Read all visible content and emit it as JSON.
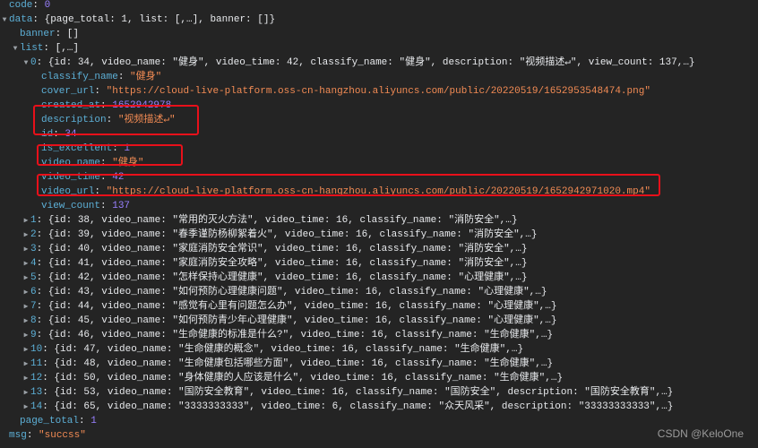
{
  "lines": [
    {
      "indent": 10,
      "tri": "",
      "parts": [
        [
          "key",
          "code"
        ],
        [
          "p",
          ": "
        ],
        [
          "num",
          "0"
        ]
      ]
    },
    {
      "indent": 10,
      "tri": "down",
      "parts": [
        [
          "key",
          "data"
        ],
        [
          "p",
          ": {page_total: 1, list: [,…], banner: []}"
        ]
      ]
    },
    {
      "indent": 22,
      "tri": "",
      "parts": [
        [
          "key",
          "banner"
        ],
        [
          "p",
          ": []"
        ]
      ]
    },
    {
      "indent": 22,
      "tri": "down",
      "parts": [
        [
          "key",
          "list"
        ],
        [
          "p",
          ": [,…]"
        ]
      ]
    },
    {
      "indent": 34,
      "tri": "down",
      "parts": [
        [
          "key",
          "0"
        ],
        [
          "p",
          ": {id: 34, video_name: \"健身\", video_time: 42, classify_name: \"健身\", description: \"视频描述↵\", view_count: 137,…}"
        ]
      ]
    },
    {
      "indent": 46,
      "tri": "",
      "parts": [
        [
          "key",
          "classify_name"
        ],
        [
          "p",
          ": "
        ],
        [
          "str",
          "\"健身\""
        ]
      ]
    },
    {
      "indent": 46,
      "tri": "",
      "parts": [
        [
          "key",
          "cover_url"
        ],
        [
          "p",
          ": "
        ],
        [
          "str",
          "\"https://cloud-live-platform.oss-cn-hangzhou.aliyuncs.com/public/20220519/1652953548474.png\""
        ]
      ]
    },
    {
      "indent": 46,
      "tri": "",
      "parts": [
        [
          "key",
          "created_at"
        ],
        [
          "p",
          ": "
        ],
        [
          "num",
          "1652942978"
        ]
      ]
    },
    {
      "indent": 46,
      "tri": "",
      "parts": [
        [
          "key",
          "description"
        ],
        [
          "p",
          ": "
        ],
        [
          "str",
          "\"视频描述↵\""
        ]
      ]
    },
    {
      "indent": 46,
      "tri": "",
      "parts": [
        [
          "key",
          "id"
        ],
        [
          "p",
          ": "
        ],
        [
          "num",
          "34"
        ]
      ]
    },
    {
      "indent": 46,
      "tri": "",
      "parts": [
        [
          "key",
          "is_excellent"
        ],
        [
          "p",
          ": "
        ],
        [
          "num",
          "1"
        ]
      ]
    },
    {
      "indent": 46,
      "tri": "",
      "parts": [
        [
          "key",
          "video_name"
        ],
        [
          "p",
          ": "
        ],
        [
          "str",
          "\"健身\""
        ]
      ]
    },
    {
      "indent": 46,
      "tri": "",
      "parts": [
        [
          "key",
          "video_time"
        ],
        [
          "p",
          ": "
        ],
        [
          "num",
          "42"
        ]
      ]
    },
    {
      "indent": 46,
      "tri": "",
      "parts": [
        [
          "key",
          "video_url"
        ],
        [
          "p",
          ": "
        ],
        [
          "str",
          "\"https://cloud-live-platform.oss-cn-hangzhou.aliyuncs.com/public/20220519/1652942971020.mp4\""
        ]
      ]
    },
    {
      "indent": 46,
      "tri": "",
      "parts": [
        [
          "key",
          "view_count"
        ],
        [
          "p",
          ": "
        ],
        [
          "num",
          "137"
        ]
      ]
    },
    {
      "indent": 34,
      "tri": "right",
      "parts": [
        [
          "key",
          "1"
        ],
        [
          "p",
          ": {id: 38, video_name: \"常用的灭火方法\", video_time: 16, classify_name: \"消防安全\",…}"
        ]
      ]
    },
    {
      "indent": 34,
      "tri": "right",
      "parts": [
        [
          "key",
          "2"
        ],
        [
          "p",
          ": {id: 39, video_name: \"春季谨防杨柳絮着火\", video_time: 16, classify_name: \"消防安全\",…}"
        ]
      ]
    },
    {
      "indent": 34,
      "tri": "right",
      "parts": [
        [
          "key",
          "3"
        ],
        [
          "p",
          ": {id: 40, video_name: \"家庭消防安全常识\", video_time: 16, classify_name: \"消防安全\",…}"
        ]
      ]
    },
    {
      "indent": 34,
      "tri": "right",
      "parts": [
        [
          "key",
          "4"
        ],
        [
          "p",
          ": {id: 41, video_name: \"家庭消防安全攻略\", video_time: 16, classify_name: \"消防安全\",…}"
        ]
      ]
    },
    {
      "indent": 34,
      "tri": "right",
      "parts": [
        [
          "key",
          "5"
        ],
        [
          "p",
          ": {id: 42, video_name: \"怎样保持心理健康\", video_time: 16, classify_name: \"心理健康\",…}"
        ]
      ]
    },
    {
      "indent": 34,
      "tri": "right",
      "parts": [
        [
          "key",
          "6"
        ],
        [
          "p",
          ": {id: 43, video_name: \"如何预防心理健康问题\", video_time: 16, classify_name: \"心理健康\",…}"
        ]
      ]
    },
    {
      "indent": 34,
      "tri": "right",
      "parts": [
        [
          "key",
          "7"
        ],
        [
          "p",
          ": {id: 44, video_name: \"感觉有心里有问题怎么办\", video_time: 16, classify_name: \"心理健康\",…}"
        ]
      ]
    },
    {
      "indent": 34,
      "tri": "right",
      "parts": [
        [
          "key",
          "8"
        ],
        [
          "p",
          ": {id: 45, video_name: \"如何预防青少年心理健康\", video_time: 16, classify_name: \"心理健康\",…}"
        ]
      ]
    },
    {
      "indent": 34,
      "tri": "right",
      "parts": [
        [
          "key",
          "9"
        ],
        [
          "p",
          ": {id: 46, video_name: \"生命健康的标准是什么?\", video_time: 16, classify_name: \"生命健康\",…}"
        ]
      ]
    },
    {
      "indent": 34,
      "tri": "right",
      "parts": [
        [
          "key",
          "10"
        ],
        [
          "p",
          ": {id: 47, video_name: \"生命健康的概念\", video_time: 16, classify_name: \"生命健康\",…}"
        ]
      ]
    },
    {
      "indent": 34,
      "tri": "right",
      "parts": [
        [
          "key",
          "11"
        ],
        [
          "p",
          ": {id: 48, video_name: \"生命健康包括哪些方面\", video_time: 16, classify_name: \"生命健康\",…}"
        ]
      ]
    },
    {
      "indent": 34,
      "tri": "right",
      "parts": [
        [
          "key",
          "12"
        ],
        [
          "p",
          ": {id: 50, video_name: \"身体健康的人应该是什么\", video_time: 16, classify_name: \"生命健康\",…}"
        ]
      ]
    },
    {
      "indent": 34,
      "tri": "right",
      "parts": [
        [
          "key",
          "13"
        ],
        [
          "p",
          ": {id: 53, video_name: \"国防安全教育\", video_time: 16, classify_name: \"国防安全\", description: \"国防安全教育\",…}"
        ]
      ]
    },
    {
      "indent": 34,
      "tri": "right",
      "parts": [
        [
          "key",
          "14"
        ],
        [
          "p",
          ": {id: 65, video_name: \"3333333333\", video_time: 6, classify_name: \"众天风采\", description: \"33333333333\",…}"
        ]
      ]
    },
    {
      "indent": 22,
      "tri": "",
      "parts": [
        [
          "key",
          "page_total"
        ],
        [
          "p",
          ": "
        ],
        [
          "num",
          "1"
        ]
      ]
    },
    {
      "indent": 10,
      "tri": "",
      "parts": [
        [
          "key",
          "msg"
        ],
        [
          "p",
          ": "
        ],
        [
          "str",
          "\"succss\""
        ]
      ]
    }
  ],
  "highlight_color": "#e8101a",
  "watermark": "CSDN @KeloOne"
}
